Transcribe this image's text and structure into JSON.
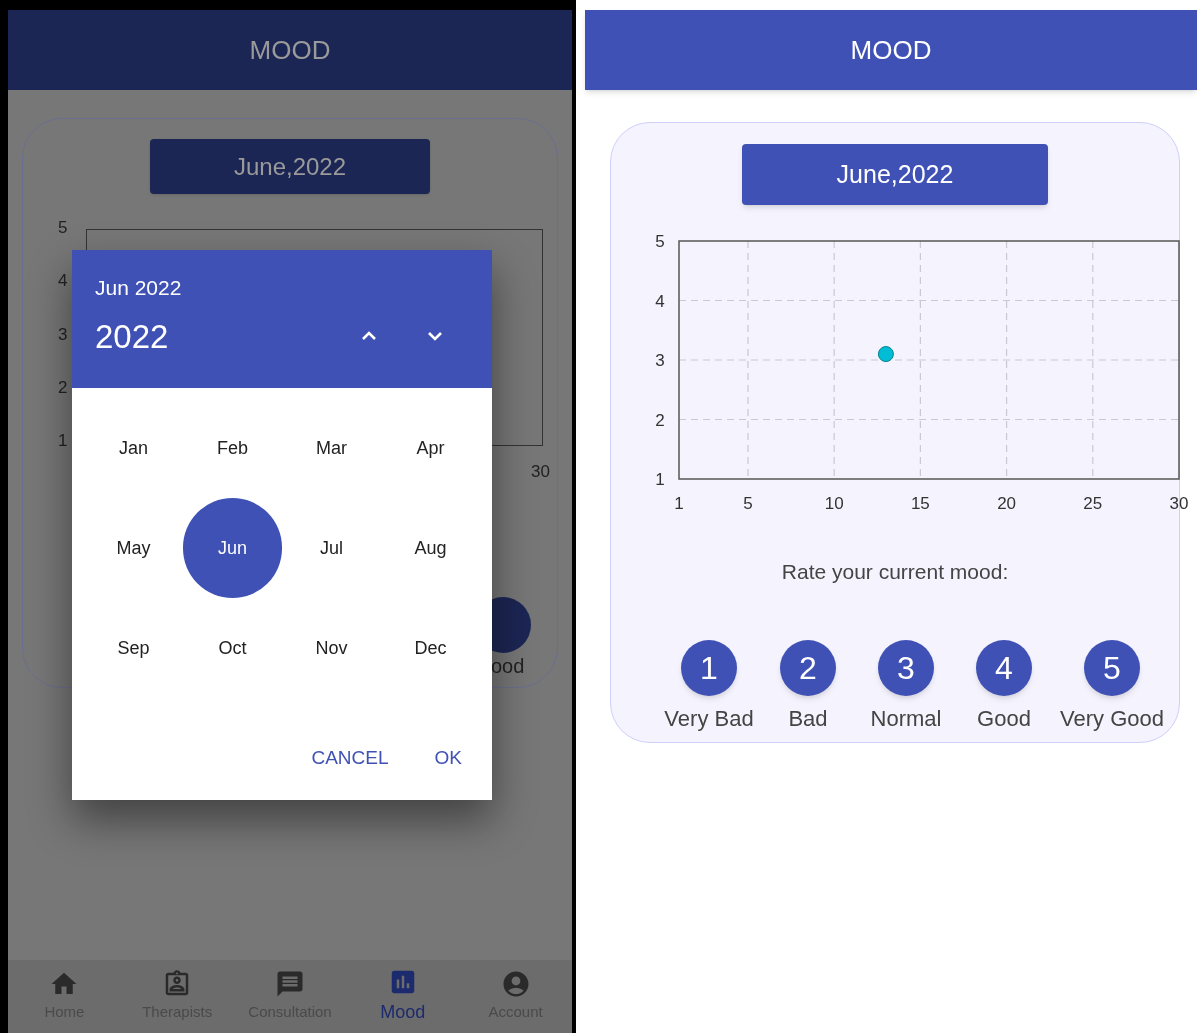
{
  "left_screen": {
    "header": {
      "title": "MOOD"
    },
    "month_button": "June,2022",
    "background_chart": {
      "y_labels": [
        "5",
        "4",
        "3",
        "2",
        "1"
      ],
      "x_end_label": "30"
    },
    "partial_rating_label": "ood",
    "date_picker": {
      "selected_label": "Jun 2022",
      "year": "2022",
      "months": [
        {
          "label": "Jan",
          "selected": false
        },
        {
          "label": "Feb",
          "selected": false
        },
        {
          "label": "Mar",
          "selected": false
        },
        {
          "label": "Apr",
          "selected": false
        },
        {
          "label": "May",
          "selected": false
        },
        {
          "label": "Jun",
          "selected": true
        },
        {
          "label": "Jul",
          "selected": false
        },
        {
          "label": "Aug",
          "selected": false
        },
        {
          "label": "Sep",
          "selected": false
        },
        {
          "label": "Oct",
          "selected": false
        },
        {
          "label": "Nov",
          "selected": false
        },
        {
          "label": "Dec",
          "selected": false
        }
      ],
      "actions": [
        "CANCEL",
        "OK"
      ]
    },
    "bottom_nav": [
      {
        "label": "Home",
        "kind": "home",
        "selected": false
      },
      {
        "label": "Therapists",
        "kind": "therapists",
        "selected": false
      },
      {
        "label": "Consultation",
        "kind": "consultation",
        "selected": false
      },
      {
        "label": "Mood",
        "kind": "mood",
        "selected": true
      },
      {
        "label": "Account",
        "kind": "account",
        "selected": false
      }
    ]
  },
  "right_screen": {
    "header": {
      "title": "MOOD"
    },
    "month_button": "June,2022",
    "chart_data": {
      "type": "scatter",
      "x": [
        13
      ],
      "series": [
        {
          "color": "#00bcd4",
          "values": [
            3.1
          ]
        }
      ],
      "xlim": [
        1,
        30
      ],
      "ylim": [
        1,
        5
      ],
      "xticks": [
        1,
        5,
        10,
        15,
        20,
        25,
        30
      ],
      "yticks": [
        1,
        2,
        3,
        4,
        5
      ],
      "grid": true
    },
    "prompt": "Rate your current mood:",
    "ratings": [
      {
        "number": "1",
        "label": "Very Bad"
      },
      {
        "number": "2",
        "label": "Bad"
      },
      {
        "number": "3",
        "label": "Normal"
      },
      {
        "number": "4",
        "label": "Good"
      },
      {
        "number": "5",
        "label": "Very Good"
      }
    ]
  }
}
